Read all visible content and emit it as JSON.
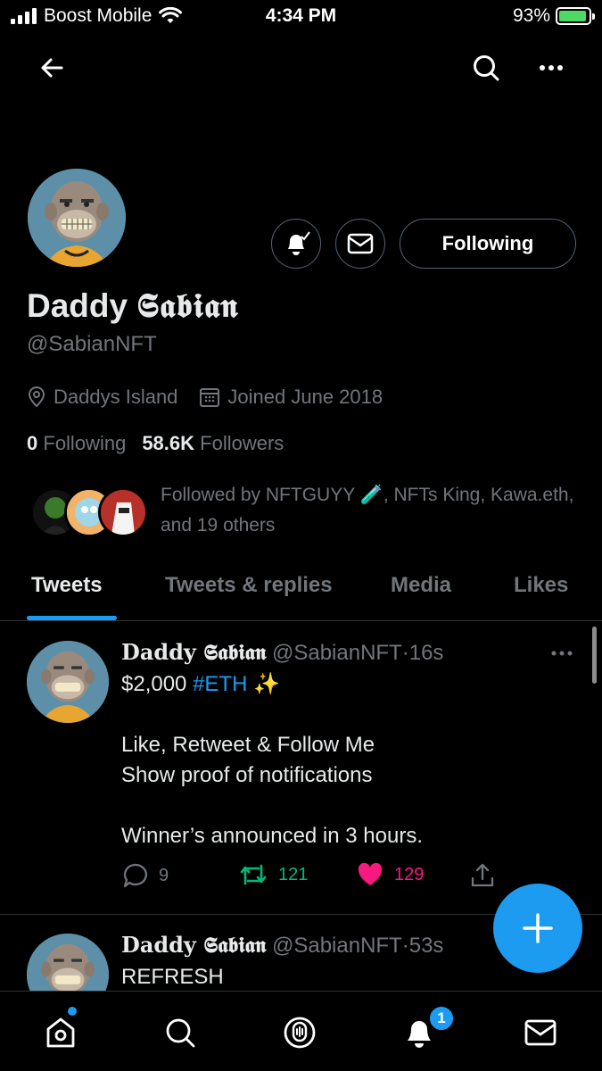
{
  "status_bar": {
    "carrier": "Boost Mobile",
    "time": "4:34 PM",
    "battery": "93%",
    "battery_level": 0.93
  },
  "profile": {
    "display_name": "Daddy ",
    "display_name_styled": "𝕾𝖆𝖇𝖎𝖆𝖓",
    "handle": "@SabianNFT",
    "location": "Daddys Island",
    "joined": "Joined June 2018",
    "following_count": "0",
    "following_label": "Following",
    "followers_count": "58.6K",
    "followers_label": "Followers",
    "followed_by": "Followed by NFTGUYY 🧪, NFTs King, Kawa.eth, and 19 others",
    "follow_button_label": "Following"
  },
  "tabs": [
    {
      "label": "Tweets",
      "active": true
    },
    {
      "label": "Tweets & replies",
      "active": false
    },
    {
      "label": "Media",
      "active": false
    },
    {
      "label": "Likes",
      "active": false
    }
  ],
  "tweets": [
    {
      "name": "Daddy 𝕾𝖆𝖇𝖎𝖆𝖓",
      "handle": "@SabianNFT",
      "time": "16s",
      "line1_prefix": "$2,000 ",
      "line1_hashtag": "#ETH",
      "line1_suffix": " ✨",
      "line2": "Like, Retweet & Follow Me",
      "line3": "Show proof of notifications",
      "line4": "Winner’s announced in 3 hours.",
      "replies": "9",
      "retweets": "121",
      "likes": "129"
    },
    {
      "name": "Daddy 𝕾𝖆𝖇𝖎𝖆𝖓",
      "handle": "@SabianNFT",
      "time": "53s",
      "line1": "REFRESH"
    }
  ],
  "bottom_nav": {
    "notifications_badge": "1"
  },
  "colors": {
    "accent": "#1d9bf0",
    "retweet": "#00ba7c",
    "like": "#f91880",
    "muted": "#71767b"
  }
}
